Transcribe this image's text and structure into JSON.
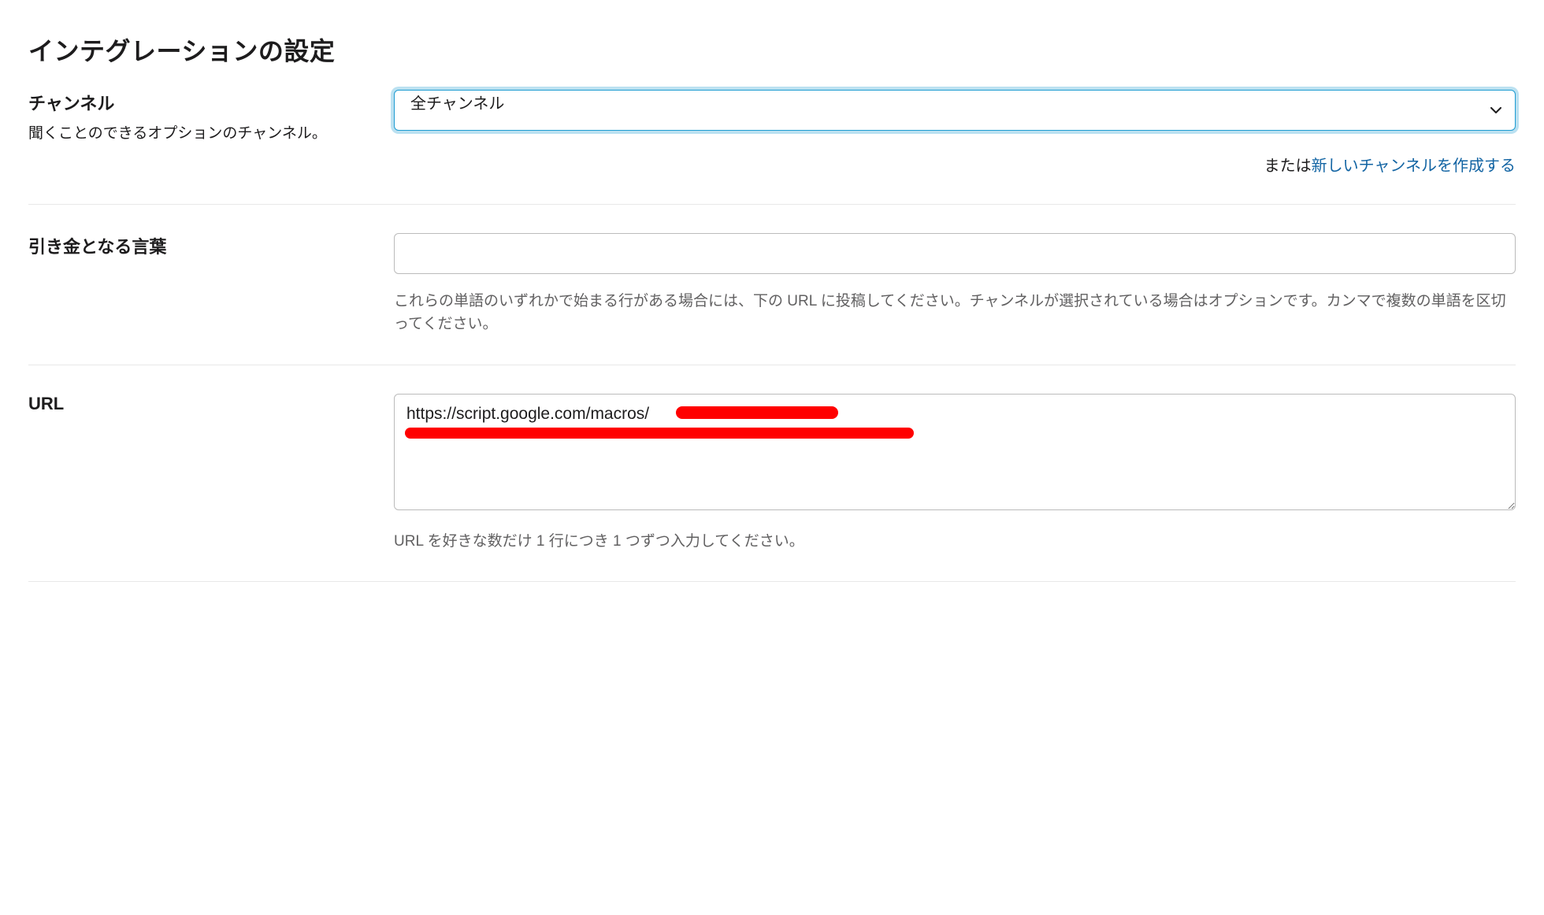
{
  "page": {
    "title": "インテグレーションの設定"
  },
  "channel": {
    "heading": "チャンネル",
    "description": "聞くことのできるオプションのチャンネル。",
    "selected": "全チャンネル",
    "helper_prefix": "または",
    "helper_link": "新しいチャンネルを作成する"
  },
  "trigger": {
    "heading": "引き金となる言葉",
    "value": "",
    "help_text": "これらの単語のいずれかで始まる行がある場合には、下の URL に投稿してください。チャンネルが選択されている場合はオプションです。カンマで複数の単語を区切ってください。"
  },
  "url": {
    "heading": "URL",
    "value_visible": "https://script.google.com/macros/",
    "help_text": "URL を好きな数だけ 1 行につき 1 つずつ入力してください。"
  }
}
